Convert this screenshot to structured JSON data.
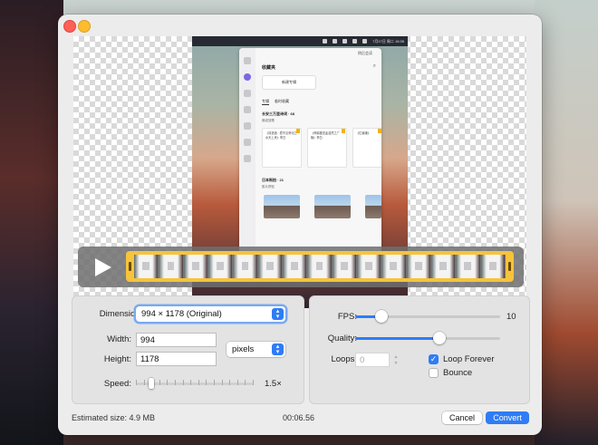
{
  "window": {
    "title": ""
  },
  "colors": {
    "accent": "#2f7cf6",
    "timeline_frame": "#f6c33b"
  },
  "preview": {
    "menubar": {
      "clock": "7月17日 周二 15:35"
    },
    "app": {
      "brand": "稍后会读",
      "title": "收藏夹",
      "new_folder": "新建专辑",
      "tabs": [
        "专辑",
        "临时收藏"
      ],
      "section1": {
        "title": "长安三万里诗词 · 68",
        "owner": "佛说放歌"
      },
      "cards": [
        "《将进酒 · 君不见黄河之水天上来》李白",
        "《黄鹤楼送孟浩然之广陵》李白",
        "《忆秦娥》"
      ],
      "section2": {
        "title": "日本街拍 · 21",
        "owner": "胶片拼贴"
      }
    }
  },
  "timeline": {
    "play_icon": "play-icon",
    "frame_count": 15
  },
  "settings": {
    "dimensions": {
      "label": "Dimensions:",
      "value": "994 × 1178 (Original)"
    },
    "width": {
      "label": "Width:",
      "value": "994"
    },
    "height": {
      "label": "Height:",
      "value": "1178"
    },
    "unit": {
      "value": "pixels"
    },
    "speed": {
      "label": "Speed:",
      "value_text": "1.5×",
      "value": 1.5
    },
    "fps": {
      "label": "FPS:",
      "value_text": "10",
      "value": 10
    },
    "quality": {
      "label": "Quality:",
      "value": 0.58
    },
    "loops": {
      "label": "Loops:",
      "value": "0"
    },
    "loop_forever": {
      "label": "Loop Forever",
      "checked": true
    },
    "bounce": {
      "label": "Bounce",
      "checked": false
    }
  },
  "footer": {
    "estimated_size": "Estimated size: 4.9 MB",
    "duration": "00:06.56",
    "cancel_label": "Cancel",
    "convert_label": "Convert"
  }
}
